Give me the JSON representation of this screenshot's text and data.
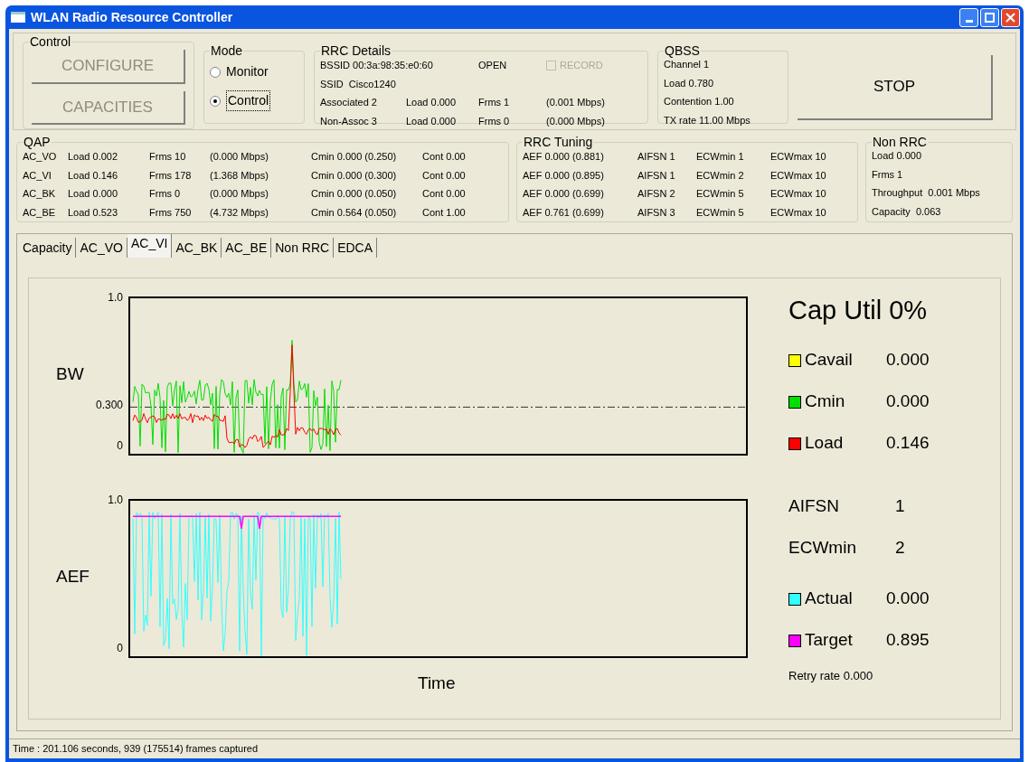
{
  "window": {
    "title": "WLAN Radio Resource Controller"
  },
  "control": {
    "label": "Control",
    "buttons": [
      {
        "label": "CONFIGURE",
        "disabled": true
      },
      {
        "label": "CAPACITIES",
        "disabled": true
      }
    ]
  },
  "mode": {
    "label": "Mode",
    "options": [
      {
        "label": "Monitor",
        "selected": false
      },
      {
        "label": "Control",
        "selected": true
      }
    ]
  },
  "rrc_details": {
    "label": "RRC Details",
    "bssid": "BSSID 00:3a:98:35:e0:60",
    "security": "OPEN",
    "record": {
      "label": "RECORD",
      "checked": false,
      "disabled": true
    },
    "ssid": "SSID  Cisco1240",
    "rows": [
      [
        "Associated 2",
        "Load 0.000",
        "Frms 1",
        "(0.001 Mbps)"
      ],
      [
        "Non-Assoc 3",
        "Load 0.000",
        "Frms 0",
        "(0.000 Mbps)"
      ]
    ]
  },
  "qbss": {
    "label": "QBSS",
    "lines": [
      "Channel 1",
      "Load 0.780",
      "Contention 1.00",
      "TX rate 11.00 Mbps"
    ]
  },
  "stop_button": "STOP",
  "qap": {
    "label": "QAP",
    "rows": [
      [
        "AC_VO",
        "Load 0.002",
        "Frms 10",
        "(0.000 Mbps)",
        "Cmin 0.000 (0.250)",
        "Cont 0.00"
      ],
      [
        "AC_VI",
        "Load 0.146",
        "Frms 178",
        "(1.368 Mbps)",
        "Cmin 0.000 (0.300)",
        "Cont 0.00"
      ],
      [
        "AC_BK",
        "Load 0.000",
        "Frms 0",
        "(0.000 Mbps)",
        "Cmin 0.000 (0.050)",
        "Cont 0.00"
      ],
      [
        "AC_BE",
        "Load 0.523",
        "Frms 750",
        "(4.732 Mbps)",
        "Cmin 0.564 (0.050)",
        "Cont 1.00"
      ]
    ]
  },
  "rrc_tuning": {
    "label": "RRC Tuning",
    "rows": [
      [
        "AEF 0.000 (0.881)",
        "AIFSN 1",
        "ECWmin 1",
        "ECWmax 10"
      ],
      [
        "AEF 0.000 (0.895)",
        "AIFSN 1",
        "ECWmin 2",
        "ECWmax 10"
      ],
      [
        "AEF 0.000 (0.699)",
        "AIFSN 2",
        "ECWmin 5",
        "ECWmax 10"
      ],
      [
        "AEF 0.761 (0.699)",
        "AIFSN 3",
        "ECWmin 5",
        "ECWmax 10"
      ]
    ]
  },
  "non_rrc": {
    "label": "Non  RRC",
    "lines": [
      "Load 0.000",
      "Frms 1",
      "Throughput  0.001 Mbps",
      "Capacity  0.063"
    ]
  },
  "tabs": [
    {
      "label": "Capacity",
      "selected": false
    },
    {
      "label": "AC_VO",
      "selected": false
    },
    {
      "label": "AC_VI",
      "selected": true
    },
    {
      "label": "AC_BK",
      "selected": false
    },
    {
      "label": "AC_BE",
      "selected": false
    },
    {
      "label": "Non RRC",
      "selected": false
    },
    {
      "label": "EDCA",
      "selected": false
    }
  ],
  "bw_chart": {
    "label": "BW",
    "ticks": [
      "1.0",
      "0.300",
      "0"
    ]
  },
  "aef_chart": {
    "label": "AEF",
    "ticks": [
      "1.0",
      "0"
    ]
  },
  "xlabel": "Time",
  "cap_util": "Cap Util 0%",
  "bw_legend": [
    {
      "label": "Cavail",
      "value": "0.000",
      "color": "#ffff00"
    },
    {
      "label": "Cmin",
      "value": "0.000",
      "color": "#00e000"
    },
    {
      "label": "Load",
      "value": "0.146",
      "color": "#ff0000"
    }
  ],
  "params": [
    {
      "label": "AIFSN",
      "value": "1"
    },
    {
      "label": "ECWmin",
      "value": "2"
    }
  ],
  "aef_legend": [
    {
      "label": "Actual",
      "value": "0.000",
      "color": "#33ffff"
    },
    {
      "label": "Target",
      "value": "0.895",
      "color": "#ff00ff"
    }
  ],
  "retry_rate": "Retry rate 0.000",
  "status_bar": "Time : 201.106 seconds, 939 (175514) frames captured"
}
